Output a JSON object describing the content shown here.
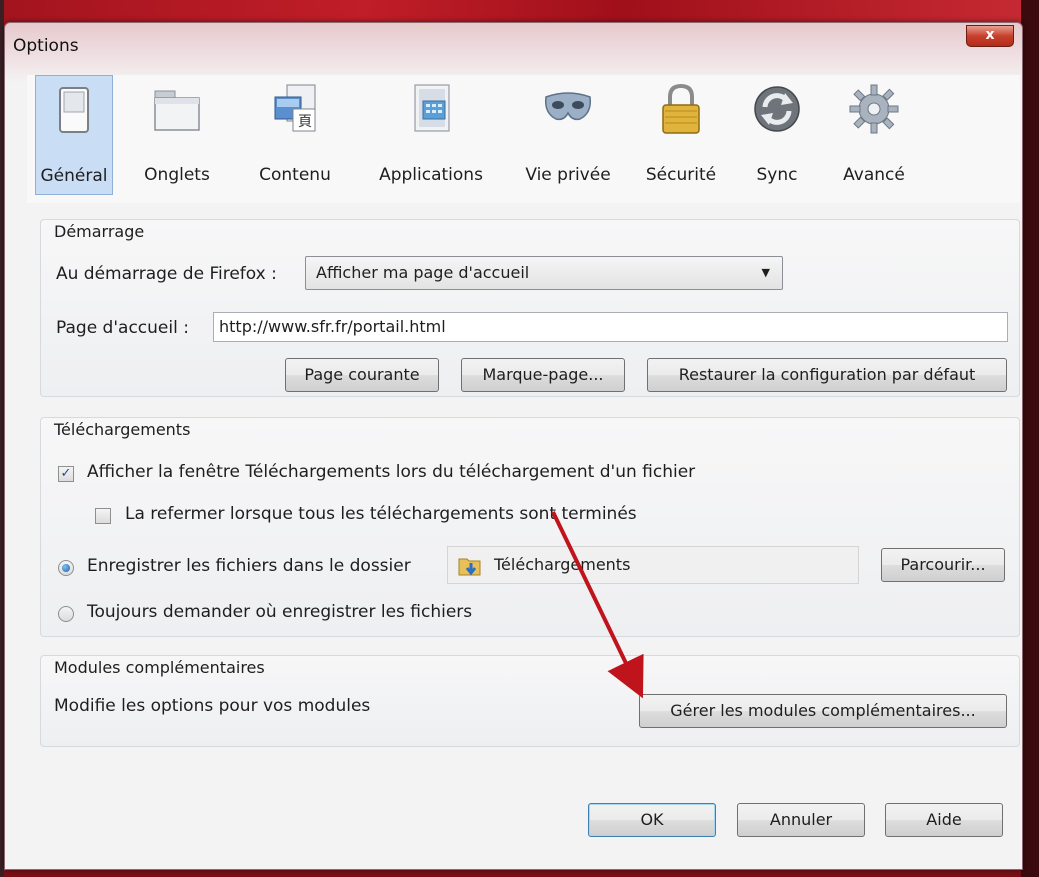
{
  "window": {
    "title": "Options",
    "close_glyph": "x"
  },
  "toolbar": [
    {
      "label": "Général",
      "icon": "switch-icon",
      "selected": true
    },
    {
      "label": "Onglets",
      "icon": "tabs-window-icon",
      "selected": false
    },
    {
      "label": "Contenu",
      "icon": "content-icon",
      "selected": false
    },
    {
      "label": "Applications",
      "icon": "applications-icon",
      "selected": false
    },
    {
      "label": "Vie privée",
      "icon": "mask-icon",
      "selected": false
    },
    {
      "label": "Sécurité",
      "icon": "padlock-icon",
      "selected": false
    },
    {
      "label": "Sync",
      "icon": "sync-icon",
      "selected": false
    },
    {
      "label": "Avancé",
      "icon": "gear-icon",
      "selected": false
    }
  ],
  "startup": {
    "group_title": "Démarrage",
    "when_label": "Au démarrage de Firefox :",
    "when_value": "Afficher ma page d'accueil",
    "home_label": "Page d'accueil :",
    "home_value": "http://www.sfr.fr/portail.html",
    "btn_current": "Page courante",
    "btn_bookmark": "Marque-page...",
    "btn_restore": "Restaurer la configuration par défaut"
  },
  "downloads": {
    "group_title": "Téléchargements",
    "show_window_label": "Afficher la fenêtre Téléchargements lors du téléchargement d'un fichier",
    "show_window_checked": true,
    "close_when_done_label": "La refermer lorsque tous les téléchargements sont terminés",
    "close_when_done_checked": false,
    "save_to_label": "Enregistrer les fichiers dans le dossier",
    "save_to_selected": true,
    "folder_name": "Téléchargements",
    "browse_button": "Parcourir...",
    "always_ask_label": "Toujours demander où enregistrer les fichiers"
  },
  "addons": {
    "group_title": "Modules complémentaires",
    "description": "Modifie les options pour vos modules",
    "manage_button": "Gérer les modules complémentaires..."
  },
  "footer": {
    "ok": "OK",
    "cancel": "Annuler",
    "help": "Aide"
  },
  "colors": {
    "selected_tab_bg": "#c9ddf4",
    "annotation_arrow": "#c0141c",
    "background_red": "#a3141e"
  }
}
